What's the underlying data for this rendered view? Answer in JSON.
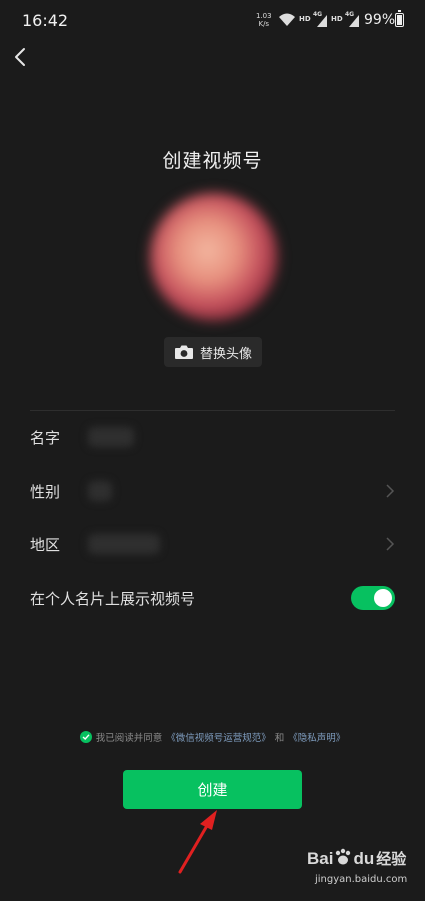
{
  "status_bar": {
    "time": "16:42",
    "speed_value": "1.03",
    "speed_unit": "K/s",
    "hd1": "HD",
    "net1": "4G",
    "hd2": "HD",
    "net2": "4G",
    "battery": "99%"
  },
  "header": {
    "back_icon": "chevron-left-icon"
  },
  "page": {
    "title": "创建视频号",
    "replace_avatar_label": "替换头像",
    "camera_icon": "camera-icon"
  },
  "form": {
    "name_label": "名字",
    "gender_label": "性别",
    "region_label": "地区",
    "show_on_card_label": "在个人名片上展示视频号",
    "show_on_card_enabled": true
  },
  "agreement": {
    "prefix": "我已阅读并同意",
    "link1": "《微信视频号运营规范》",
    "middle": "和",
    "link2": "《隐私声明》"
  },
  "actions": {
    "create_label": "创建"
  },
  "watermark": {
    "brand_a": "Bai",
    "brand_b": "du",
    "brand_c": "经验",
    "url": "jingyan.baidu.com"
  },
  "colors": {
    "accent": "#07c160",
    "background": "#1b1b1b",
    "arrow": "#e02020"
  }
}
